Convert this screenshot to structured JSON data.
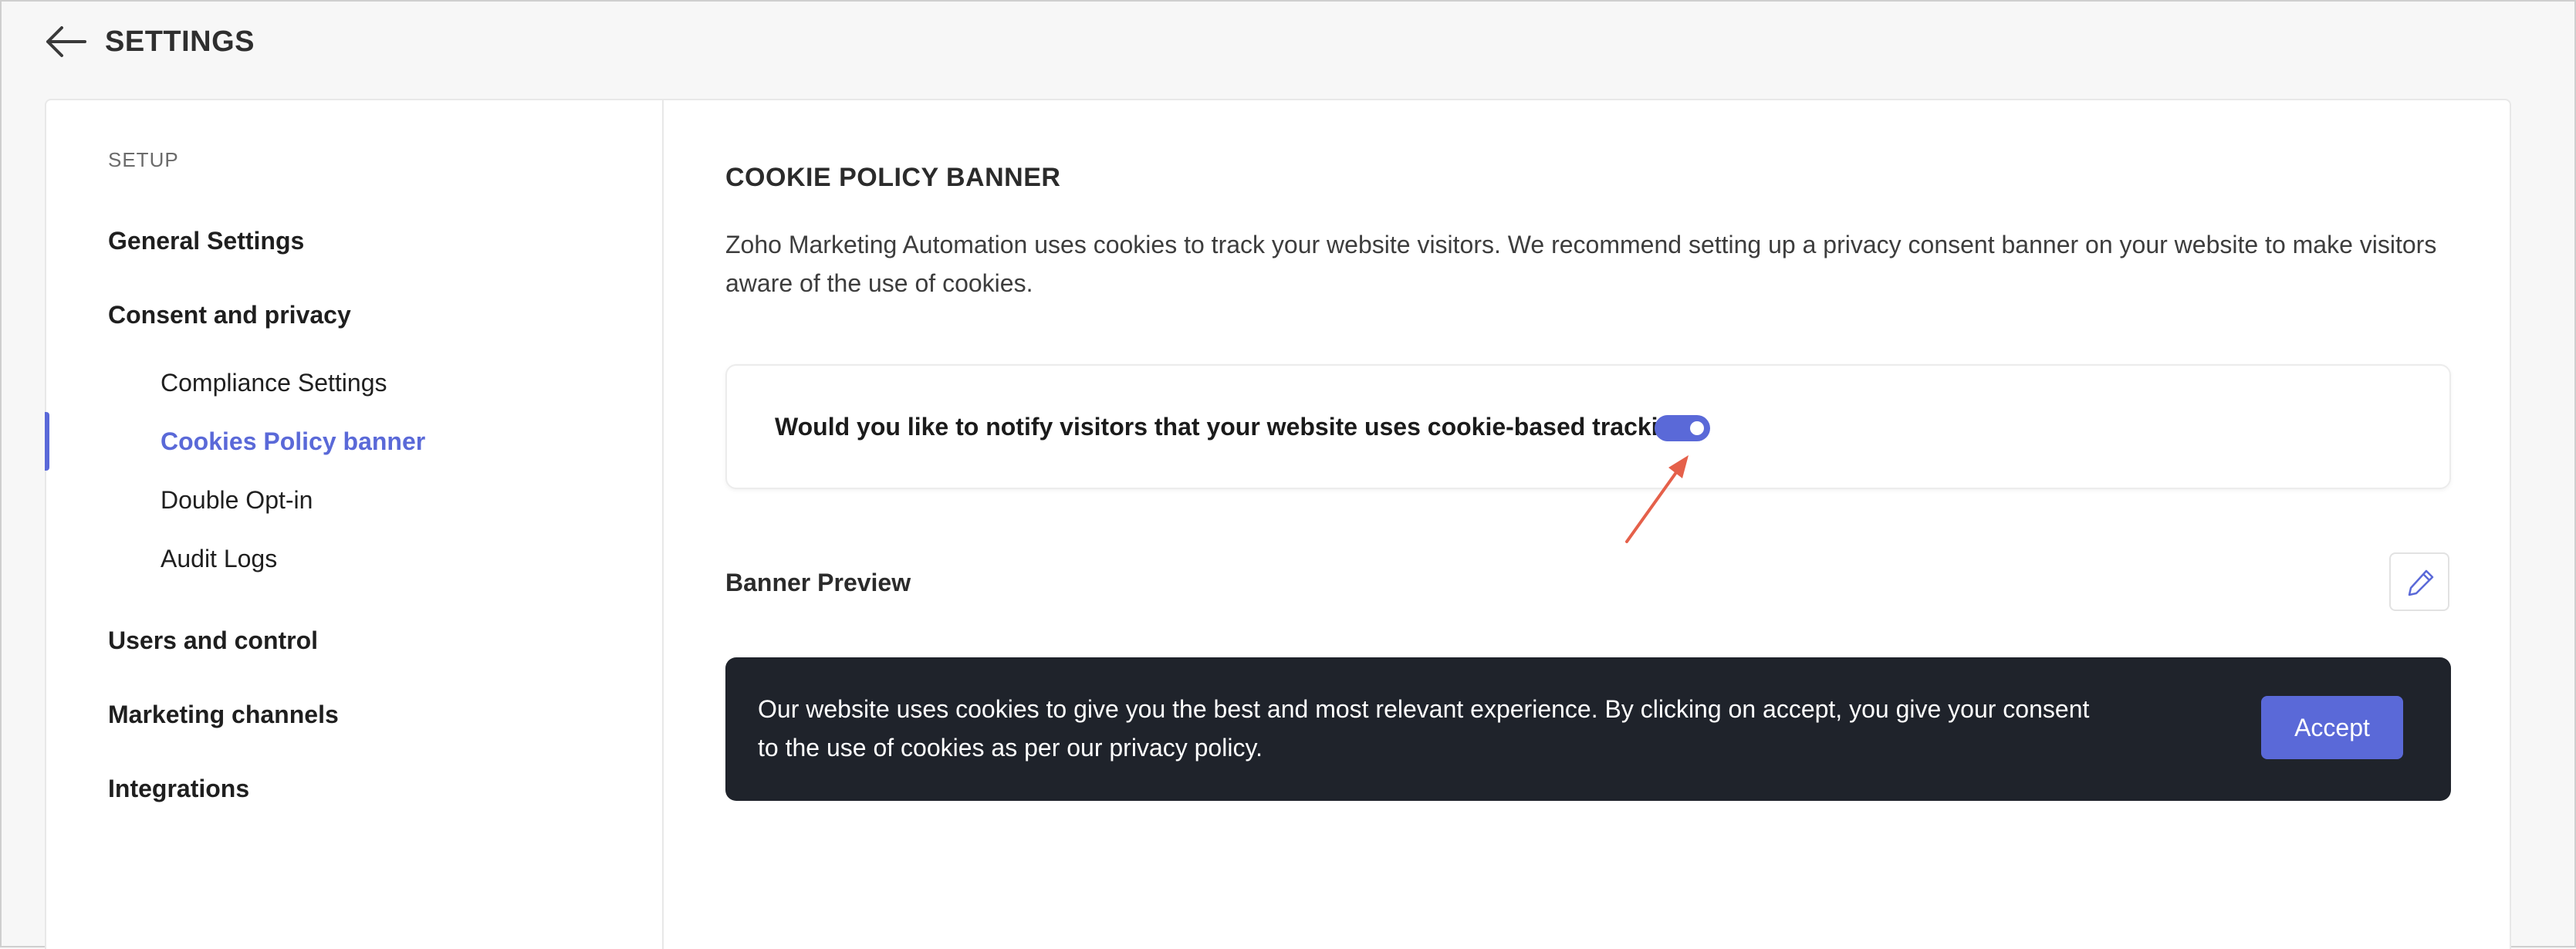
{
  "header": {
    "back_icon": "arrow-left-icon",
    "title": "SETTINGS"
  },
  "sidebar": {
    "section_label": "SETUP",
    "groups": [
      {
        "label": "General Settings"
      },
      {
        "label": "Consent and privacy"
      },
      {
        "label": "Users and control"
      },
      {
        "label": "Marketing channels"
      },
      {
        "label": "Integrations"
      }
    ],
    "consent_items": [
      {
        "label": "Compliance Settings",
        "active": false
      },
      {
        "label": "Cookies Policy banner",
        "active": true
      },
      {
        "label": "Double Opt-in",
        "active": false
      },
      {
        "label": "Audit Logs",
        "active": false
      }
    ]
  },
  "main": {
    "title": "COOKIE POLICY BANNER",
    "description": "Zoho Marketing Automation uses cookies to track your website visitors. We recommend setting up a privacy consent banner on your website to make visitors aware of the use of cookies.",
    "notify": {
      "question": "Would you like to notify visitors that your website uses cookie-based tracking?",
      "toggle_on": true
    },
    "preview": {
      "label": "Banner Preview",
      "edit_icon": "pencil-icon"
    },
    "banner": {
      "text": "Our website uses cookies to give you the best and most relevant experience. By clicking on accept, you give your consent to the use of cookies as per our privacy policy.",
      "accept_label": "Accept"
    }
  },
  "colors": {
    "accent": "#5a69d8",
    "banner_bg": "#1f232b",
    "annotation_arrow": "#e5604a"
  }
}
